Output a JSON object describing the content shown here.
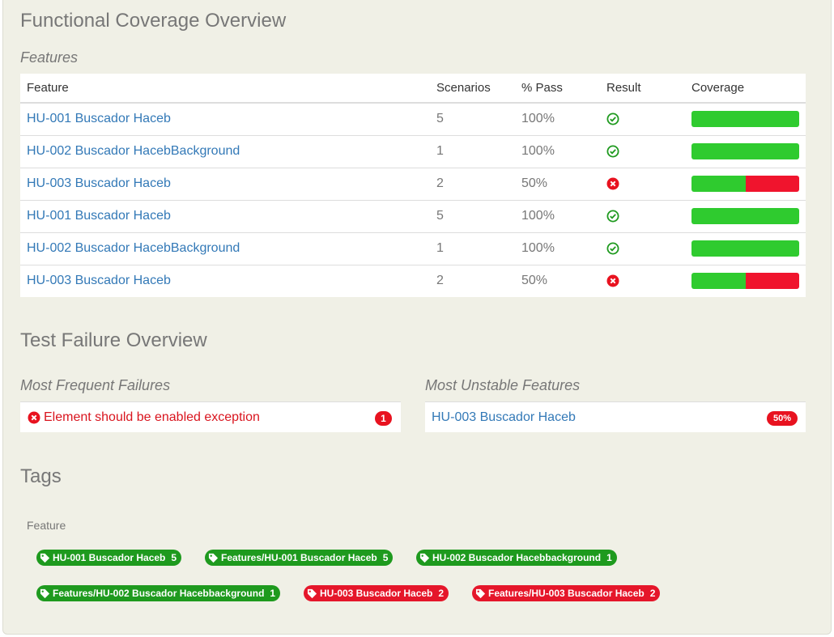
{
  "coverage": {
    "title": "Functional Coverage Overview",
    "subtitle": "Features",
    "columns": [
      "Feature",
      "Scenarios",
      "% Pass",
      "Result",
      "Coverage"
    ],
    "rows": [
      {
        "feature": "HU-001 Buscador Haceb",
        "scenarios": "5",
        "pass": "100%",
        "result": "passed",
        "coverage_pass_fraction": 1.0
      },
      {
        "feature": "HU-002 Buscador HacebBackground",
        "scenarios": "1",
        "pass": "100%",
        "result": "passed",
        "coverage_pass_fraction": 1.0
      },
      {
        "feature": "HU-003 Buscador Haceb",
        "scenarios": "2",
        "pass": "50%",
        "result": "failed",
        "coverage_pass_fraction": 0.5
      },
      {
        "feature": "HU-001 Buscador Haceb",
        "scenarios": "5",
        "pass": "100%",
        "result": "passed",
        "coverage_pass_fraction": 1.0
      },
      {
        "feature": "HU-002 Buscador HacebBackground",
        "scenarios": "1",
        "pass": "100%",
        "result": "passed",
        "coverage_pass_fraction": 1.0
      },
      {
        "feature": "HU-003 Buscador Haceb",
        "scenarios": "2",
        "pass": "50%",
        "result": "failed",
        "coverage_pass_fraction": 0.5
      }
    ]
  },
  "failures": {
    "title": "Test Failure Overview",
    "frequent": {
      "heading": "Most Frequent Failures",
      "items": [
        {
          "text": "Element should be enabled exception",
          "count": "1",
          "icon": "error-circle-icon"
        }
      ]
    },
    "unstable": {
      "heading": "Most Unstable Features",
      "items": [
        {
          "text": "HU-003 Buscador Haceb",
          "badge": "50%"
        }
      ]
    }
  },
  "tags": {
    "title": "Tags",
    "group_label": "Feature",
    "items": [
      {
        "label": "HU-001 Buscador Haceb",
        "count": "5",
        "status": "green"
      },
      {
        "label": "Features/HU-001 Buscador Haceb",
        "count": "5",
        "status": "green"
      },
      {
        "label": "HU-002 Buscador Hacebbackground",
        "count": "1",
        "status": "green"
      },
      {
        "label": "Features/HU-002 Buscador Hacebbackground",
        "count": "1",
        "status": "green"
      },
      {
        "label": "HU-003 Buscador Haceb",
        "count": "2",
        "status": "red"
      },
      {
        "label": "Features/HU-003 Buscador Haceb",
        "count": "2",
        "status": "red"
      }
    ]
  },
  "colors": {
    "pass": "#2fcb2f",
    "fail": "#f0142d",
    "link": "#3379b7",
    "tag_green": "#1e9a1e",
    "tag_red": "#e5162a"
  }
}
